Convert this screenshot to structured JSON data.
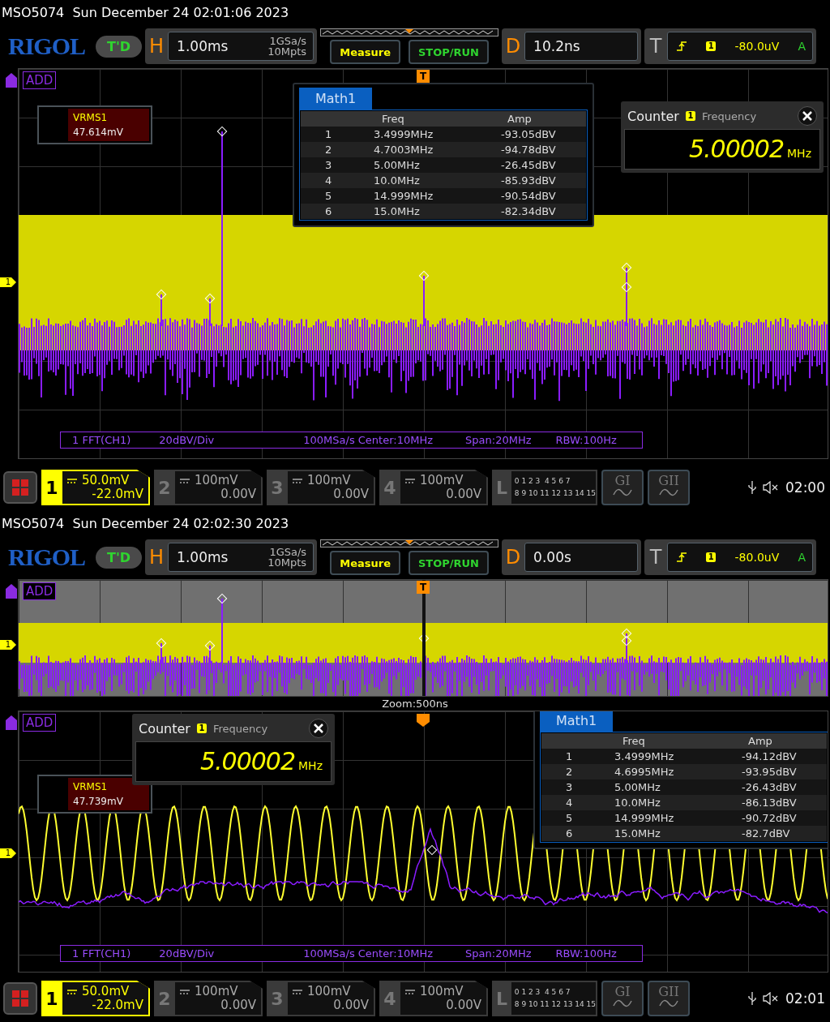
{
  "screens": [
    {
      "header": "MSO5074  Sun December 24 02:01:06 2023",
      "logo": "RIGOL",
      "badge": "T'D",
      "horizontal": {
        "label": "H",
        "timebase": "1.00ms",
        "sample_rate": "1GSa/s",
        "memory_depth": "10Mpts"
      },
      "buttons": [
        {
          "label": "Measure",
          "kind": "measure"
        },
        {
          "label": "STOP/RUN",
          "kind": "run"
        }
      ],
      "delay": {
        "label": "D",
        "value": "10.2ns"
      },
      "trigger": {
        "label": "T",
        "source": "1",
        "level": "-80.0uV",
        "mode": "A"
      },
      "view": {
        "kind": "spectrum",
        "math_label": "ADD",
        "channel_marker": "1",
        "trigger_marker": "T",
        "measurement": {
          "name": "VRMS1",
          "value": "47.614mV"
        },
        "math_table": {
          "title": "Math1",
          "columns": [
            "Freq",
            "Amp"
          ],
          "rows": [
            {
              "index": "1",
              "freq": "3.4999MHz",
              "amp": "-93.05dBV"
            },
            {
              "index": "2",
              "freq": "4.7003MHz",
              "amp": "-94.78dBV"
            },
            {
              "index": "3",
              "freq": "5.00MHz",
              "amp": "-26.45dBV"
            },
            {
              "index": "4",
              "freq": "10.0MHz",
              "amp": "-85.93dBV"
            },
            {
              "index": "5",
              "freq": "14.999MHz",
              "amp": "-90.54dBV"
            },
            {
              "index": "6",
              "freq": "15.0MHz",
              "amp": "-82.34dBV"
            }
          ]
        },
        "counter": {
          "title": "Counter",
          "source": "1",
          "parameter": "Frequency",
          "value": "5.00002",
          "unit": "MHz"
        },
        "fft_info": [
          "1 FFT(CH1)",
          "20dBV/Div",
          "100MSa/s Center:10MHz",
          "Span:20MHz",
          "RBW:100Hz"
        ]
      },
      "channels": [
        {
          "number": "1",
          "scale": "50.0mV",
          "offset": "-22.0mV",
          "selected": true
        },
        {
          "number": "2",
          "scale": "100mV",
          "offset": "0.00V",
          "selected": false
        },
        {
          "number": "3",
          "scale": "100mV",
          "offset": "0.00V",
          "selected": false
        },
        {
          "number": "4",
          "scale": "100mV",
          "offset": "0.00V",
          "selected": false
        }
      ],
      "logic": {
        "label": "L",
        "rows": [
          "0 1 2 3  4 5 6 7",
          "8 9 10 11 12 13 14 15"
        ]
      },
      "generators": [
        "GI",
        "GII"
      ],
      "clock": "02:00"
    },
    {
      "header": "MSO5074  Sun December 24 02:02:30 2023",
      "logo": "RIGOL",
      "badge": "T'D",
      "horizontal": {
        "label": "H",
        "timebase": "1.00ms",
        "sample_rate": "1GSa/s",
        "memory_depth": "10Mpts"
      },
      "buttons": [
        {
          "label": "Measure",
          "kind": "measure"
        },
        {
          "label": "STOP/RUN",
          "kind": "run"
        }
      ],
      "delay": {
        "label": "D",
        "value": "0.00s"
      },
      "trigger": {
        "label": "T",
        "source": "1",
        "level": "-80.0uV",
        "mode": "A"
      },
      "zoom_overview": {
        "math_label": "ADD",
        "channel_marker": "1",
        "trigger_marker": "T",
        "caption": "Zoom:500ns"
      },
      "view": {
        "kind": "zoomed",
        "math_label": "ADD",
        "channel_marker": "1",
        "measurement": {
          "name": "VRMS1",
          "value": "47.739mV"
        },
        "math_table": {
          "title": "Math1",
          "columns": [
            "Freq",
            "Amp"
          ],
          "rows": [
            {
              "index": "1",
              "freq": "3.4999MHz",
              "amp": "-94.12dBV"
            },
            {
              "index": "2",
              "freq": "4.6995MHz",
              "amp": "-93.95dBV"
            },
            {
              "index": "3",
              "freq": "5.00MHz",
              "amp": "-26.43dBV"
            },
            {
              "index": "4",
              "freq": "10.0MHz",
              "amp": "-86.13dBV"
            },
            {
              "index": "5",
              "freq": "14.999MHz",
              "amp": "-90.72dBV"
            },
            {
              "index": "6",
              "freq": "15.0MHz",
              "amp": "-82.7dBV"
            }
          ]
        },
        "counter": {
          "title": "Counter",
          "source": "1",
          "parameter": "Frequency",
          "value": "5.00002",
          "unit": "MHz"
        },
        "fft_info": [
          "1 FFT(CH1)",
          "20dBV/Div",
          "100MSa/s Center:10MHz",
          "Span:20MHz",
          "RBW:100Hz"
        ]
      },
      "channels": [
        {
          "number": "1",
          "scale": "50.0mV",
          "offset": "-22.0mV",
          "selected": true
        },
        {
          "number": "2",
          "scale": "100mV",
          "offset": "0.00V",
          "selected": false
        },
        {
          "number": "3",
          "scale": "100mV",
          "offset": "0.00V",
          "selected": false
        },
        {
          "number": "4",
          "scale": "100mV",
          "offset": "0.00V",
          "selected": false
        }
      ],
      "logic": {
        "label": "L",
        "rows": [
          "0 1 2 3  4 5 6 7",
          "8 9 10 11 12 13 14 15"
        ]
      },
      "generators": [
        "GI",
        "GII"
      ],
      "clock": "02:01"
    }
  ]
}
